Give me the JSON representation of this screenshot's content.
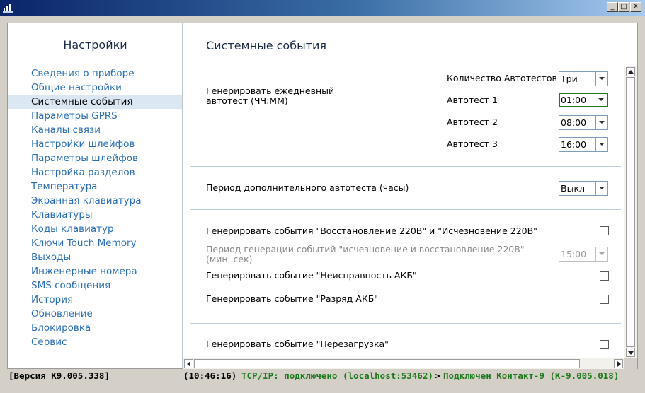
{
  "sidebar": {
    "title": "Настройки",
    "items": [
      {
        "label": "Сведения о приборе",
        "active": false
      },
      {
        "label": "Общие настройки",
        "active": false
      },
      {
        "label": "Системные события",
        "active": true
      },
      {
        "label": "Параметры GPRS",
        "active": false
      },
      {
        "label": "Каналы связи",
        "active": false
      },
      {
        "label": "Настройки шлейфов",
        "active": false
      },
      {
        "label": "Параметры шлейфов",
        "active": false
      },
      {
        "label": "Настройка разделов",
        "active": false
      },
      {
        "label": "Температура",
        "active": false
      },
      {
        "label": "Экранная клавиатура",
        "active": false
      },
      {
        "label": "Клавиатуры",
        "active": false
      },
      {
        "label": "Коды клавиатур",
        "active": false
      },
      {
        "label": "Ключи Touch Memory",
        "active": false
      },
      {
        "label": "Выходы",
        "active": false
      },
      {
        "label": "Инженерные номера",
        "active": false
      },
      {
        "label": "SMS сообщения",
        "active": false
      },
      {
        "label": "История",
        "active": false
      },
      {
        "label": "Обновление",
        "active": false
      },
      {
        "label": "Блокировка",
        "active": false
      },
      {
        "label": "Сервис",
        "active": false
      }
    ]
  },
  "main": {
    "title": "Системные события",
    "daily_autotest": {
      "label_line1": "Генерировать ежедневный",
      "label_line2": "автотест (ЧЧ:ММ)",
      "count_label": "Количество Автотестов",
      "count_value": "Три",
      "test1_label": "Автотест 1",
      "test1_value": "01:00",
      "test2_label": "Автотест 2",
      "test2_value": "08:00",
      "test3_label": "Автотест 3",
      "test3_value": "16:00"
    },
    "extra_period": {
      "label": "Период дополнительного автотеста (часы)",
      "value": "Выкл"
    },
    "power_events": {
      "label": "Генерировать события \"Восстановление 220В\" и \"Исчезновение 220В\"",
      "checked": false,
      "period_line1": "Период генерации событий \"исчезновение и восстановление 220В\"",
      "period_line2": "(мин, сек)",
      "period_value": "15:00"
    },
    "battery_fault": {
      "label": "Генерировать событие \"Неисправность АКБ\"",
      "checked": false
    },
    "battery_low": {
      "label": "Генерировать событие \"Разряд АКБ\"",
      "checked": false
    },
    "reboot": {
      "label": "Генерировать событие \"Перезагрузка\"",
      "checked": false
    }
  },
  "window": {
    "min_label": "_",
    "max_label": "□",
    "close_label": "X"
  },
  "status": {
    "version": "[Версия K9.005.338]",
    "time": "(10:46:16)",
    "connection": "TCP/IP: подключено (localhost:53462)",
    "arrow": ">",
    "device": "Подключен Контакт-9 (K-9.005.018)"
  },
  "colors": {
    "link": "#2a6fb5",
    "active_bg": "#dbe7f3",
    "status_green": "#1c7a1c",
    "focus_border": "#1c7a1c"
  }
}
